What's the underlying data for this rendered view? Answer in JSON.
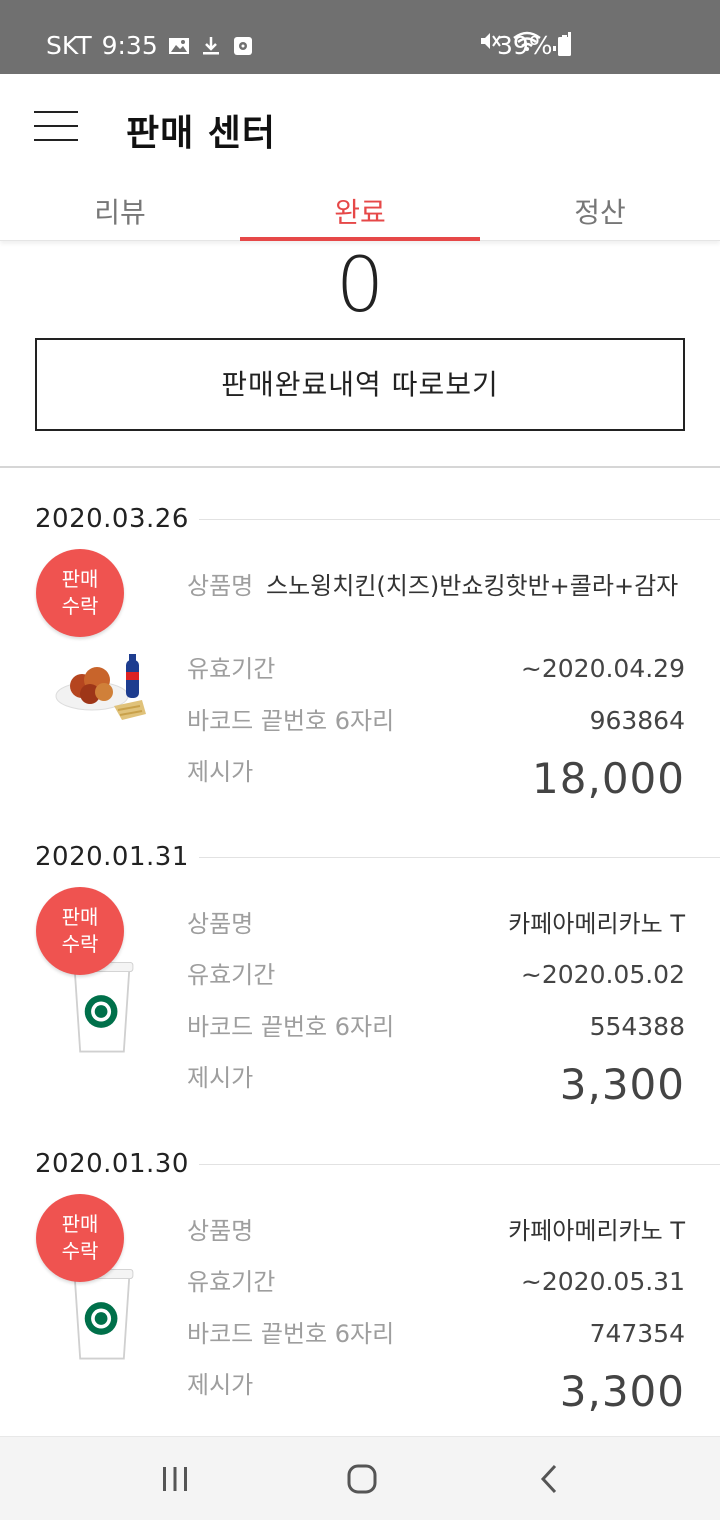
{
  "status_bar": {
    "carrier": "SKT",
    "time": "9:35",
    "battery": "39%"
  },
  "header": {
    "title": "판매 센터"
  },
  "tabs": [
    {
      "label": "리뷰",
      "active": false
    },
    {
      "label": "완료",
      "active": true
    },
    {
      "label": "정산",
      "active": false
    }
  ],
  "summary": {
    "count": "0",
    "history_button": "판매완료내역 따로보기"
  },
  "labels": {
    "product": "상품명",
    "expiry": "유효기간",
    "barcode": "바코드 끝번호 6자리",
    "price": "제시가",
    "badge_line1": "판매",
    "badge_line2": "수락"
  },
  "entries": [
    {
      "date": "2020.03.26",
      "product": "스노윙치킨(치즈)반쇼킹핫반+콜라+감자",
      "expiry": "~2020.04.29",
      "barcode": "963864",
      "price": "18,000",
      "thumb": "chicken-set-image"
    },
    {
      "date": "2020.01.31",
      "product": "카페아메리카노 T",
      "expiry": "~2020.05.02",
      "barcode": "554388",
      "price": "3,300",
      "thumb": "coffee-cup-image"
    },
    {
      "date": "2020.01.30",
      "product": "카페아메리카노 T",
      "expiry": "~2020.05.31",
      "barcode": "747354",
      "price": "3,300",
      "thumb": "coffee-cup-image"
    }
  ],
  "colors": {
    "accent": "#e64848",
    "badge": "#ef5350",
    "status_bar": "#707070"
  },
  "icons": {
    "menu": "hamburger-menu-icon",
    "nav_recent": "recent-apps-icon",
    "nav_home": "home-icon",
    "nav_back": "back-icon"
  }
}
